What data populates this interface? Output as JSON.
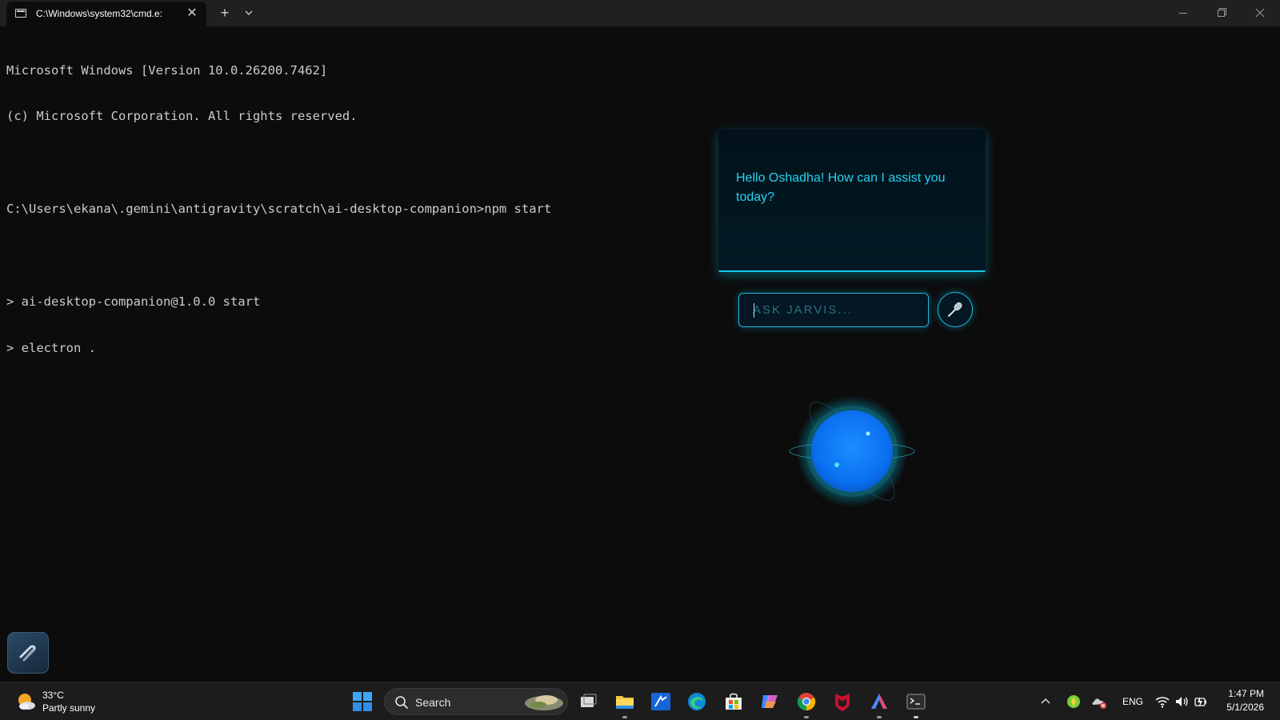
{
  "window": {
    "tab_title": "C:\\Windows\\system32\\cmd.e:",
    "tab_close_symbol": "✕",
    "new_tab_symbol": "+",
    "icons": [
      "terminal-tab-icon",
      "chevron-down-icon",
      "minimize-icon",
      "maximize-icon",
      "close-icon"
    ]
  },
  "terminal": {
    "lines": [
      "Microsoft Windows [Version 10.0.26200.7462]",
      "(c) Microsoft Corporation. All rights reserved.",
      "",
      "C:\\Users\\ekana\\.gemini\\antigravity\\scratch\\ai-desktop-companion>npm start",
      "",
      "> ai-desktop-companion@1.0.0 start",
      "> electron ."
    ]
  },
  "assistant": {
    "message": "Hello Oshadha! How can I assist you today?",
    "input_placeholder": "ASK JARVIS...",
    "input_value": "",
    "mic_icon": "microphone-icon",
    "accent_color": "#19c6e8",
    "orb_color": "#0a7cff"
  },
  "taskbar": {
    "weather": {
      "temp": "33°C",
      "desc": "Partly sunny",
      "icon": "partly-sunny-icon"
    },
    "search_label": "Search",
    "pinned": [
      "task-view-icon",
      "file-explorer-icon",
      "editor-app-icon",
      "edge-icon",
      "store-icon",
      "copilot-icon",
      "chrome-icon",
      "mcafee-icon",
      "antigravity-icon",
      "terminal-icon"
    ],
    "tray": {
      "lang": "ENG",
      "time": "1:47 PM",
      "date": "5/1/2026",
      "icons": [
        "show-hidden-icons-chevron",
        "green-status-icon",
        "onedrive-error-icon",
        "wifi-icon",
        "volume-icon",
        "battery-icon"
      ]
    }
  }
}
